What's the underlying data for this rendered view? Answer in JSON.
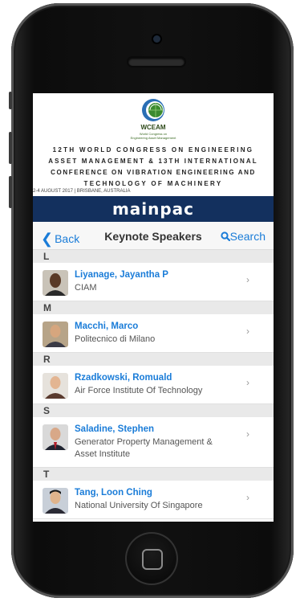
{
  "banner": {
    "logo_name": "WCEAM",
    "logo_sub_1": "World Congress on",
    "logo_sub_2": "Engineering Asset Management",
    "conf_line_1": "12TH WORLD CONGRESS ON ENGINEERING",
    "conf_line_2": "ASSET MANAGEMENT & 13TH INTERNATIONAL",
    "conf_line_3": "CONFERENCE ON VIBRATION ENGINEERING AND",
    "conf_line_4": "TECHNOLOGY OF MACHINERY",
    "date": "2-4 AUGUST 2017 | BRISBANE, AUSTRALIA"
  },
  "brand": "mainpac",
  "nav": {
    "back_label": "Back",
    "title": "Keynote Speakers",
    "search_label": "Search"
  },
  "sections": [
    {
      "letter": "L",
      "speakers": [
        {
          "name": "Liyanage, Jayantha P",
          "org": "CIAM"
        }
      ]
    },
    {
      "letter": "M",
      "speakers": [
        {
          "name": "Macchi, Marco",
          "org": "Politecnico di Milano"
        }
      ]
    },
    {
      "letter": "R",
      "speakers": [
        {
          "name": "Rzadkowski, Romuald",
          "org": "Air Force Institute Of Technology"
        }
      ]
    },
    {
      "letter": "S",
      "speakers": [
        {
          "name": "Saladine, Stephen",
          "org": "Generator Property Management & Asset Institute"
        }
      ]
    },
    {
      "letter": "T",
      "speakers": [
        {
          "name": "Tang, Loon Ching",
          "org": "National University Of Singapore"
        }
      ]
    }
  ],
  "colors": {
    "accent": "#1a7cd8",
    "brand_bar": "#13305e"
  },
  "icons": {
    "back": "chevron-left-icon",
    "search": "search-icon",
    "row": "chevron-right-icon"
  }
}
